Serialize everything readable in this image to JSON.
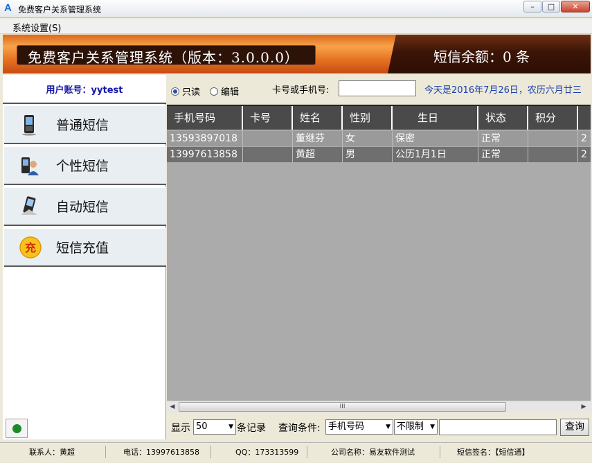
{
  "window": {
    "title": "免费客户关系管理系统",
    "min": "–",
    "max": "□",
    "close": "✕"
  },
  "menu": {
    "system_settings": "系统设置(S)"
  },
  "banner": {
    "title": "免费客户关系管理系统（版本：3.0.0.0）",
    "balance": "短信余额：0 条"
  },
  "sidebar": {
    "user_label": "用户账号：yytest",
    "items": [
      {
        "label": "普通短信",
        "icon": "phone-icon"
      },
      {
        "label": "个性短信",
        "icon": "user-phone-icon"
      },
      {
        "label": "自动短信",
        "icon": "auto-phone-icon"
      },
      {
        "label": "短信充值",
        "icon": "recharge-icon",
        "icon_text": "充"
      }
    ]
  },
  "toolbar": {
    "readonly_label": "只读",
    "edit_label": "编辑",
    "card_label": "卡号或手机号:",
    "today_text": "今天是2016年7月26日，农历六月廿三"
  },
  "table": {
    "columns": [
      "手机号码",
      "卡号",
      "姓名",
      "性别",
      "生日",
      "状态",
      "积分"
    ],
    "rows": [
      [
        "13593897018",
        "",
        "董继芬",
        "女",
        "保密",
        "正常",
        "",
        "2"
      ],
      [
        "13997613858",
        "",
        "黄超",
        "男",
        "公历1月1日",
        "正常",
        "",
        "2"
      ]
    ]
  },
  "scrollbar": {
    "left": "◀",
    "right": "▶",
    "grip": "III"
  },
  "bottom": {
    "show_label": "显示",
    "page_size": "50",
    "records_label": "条记录",
    "condition_label": "查询条件:",
    "condition_value": "手机号码",
    "limit_value": "不限制",
    "query_button": "查询"
  },
  "status": {
    "contact": "联系人：黄超",
    "phone": "电话：13997613858",
    "qq": "QQ：173313599",
    "company": "公司名称：易友软件测试",
    "signature": "短信签名：【短信通】"
  },
  "colors": {
    "banner_orange": "#e77623",
    "banner_dark": "#3b1406",
    "grid_bg": "#ababab",
    "header_bg": "#4a4a4a",
    "link_blue": "#1a3fb0"
  }
}
